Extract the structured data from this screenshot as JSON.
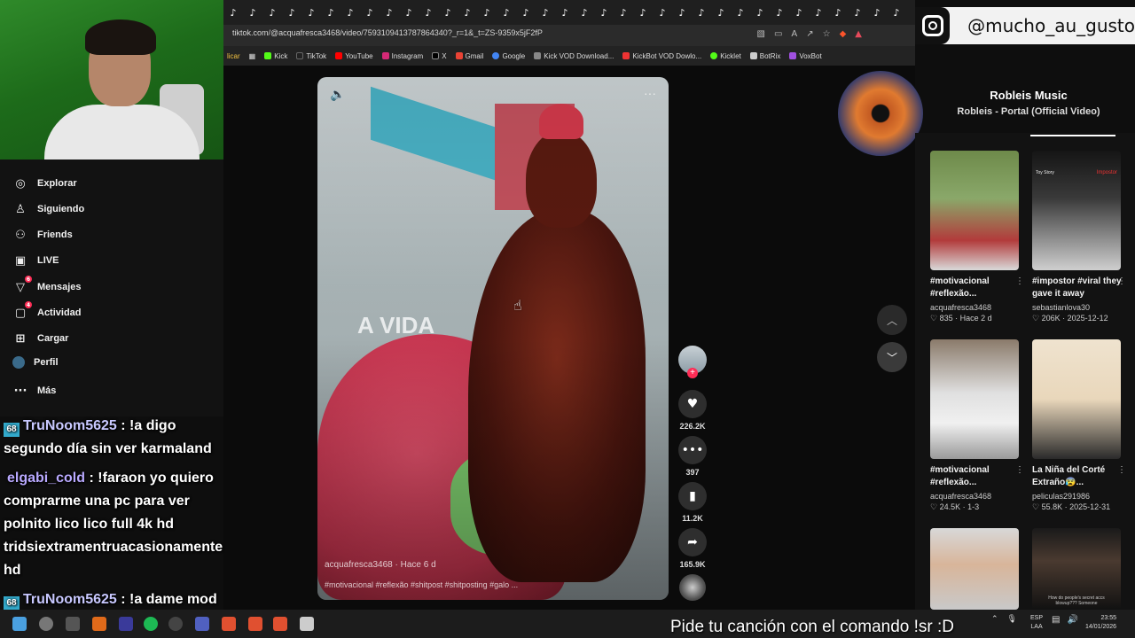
{
  "browser": {
    "url": "tiktok.com/@acquafresca3468/video/7593109413787864340?_r=1&_t=ZS-9359x5jF2fP",
    "bookmarks": [
      "Kick",
      "TikTok",
      "YouTube",
      "Instagram",
      "X",
      "Gmail",
      "Google",
      "Kick VOD Download...",
      "KickBot VOD Dowlo...",
      "Kicklet",
      "BotRix",
      "VoxBot"
    ],
    "bookmark_partial": "licar"
  },
  "instagram_overlay": {
    "handle": "@mucho_au_gusto"
  },
  "sidebar": {
    "items": [
      {
        "label": "Explorar",
        "icon": "compass-icon"
      },
      {
        "label": "Siguiendo",
        "icon": "following-icon"
      },
      {
        "label": "Friends",
        "icon": "friends-icon"
      },
      {
        "label": "LIVE",
        "icon": "live-icon"
      },
      {
        "label": "Mensajes",
        "icon": "messages-icon",
        "badge": "6"
      },
      {
        "label": "Actividad",
        "icon": "activity-icon",
        "badge": "4"
      },
      {
        "label": "Cargar",
        "icon": "upload-icon"
      },
      {
        "label": "Perfil",
        "icon": "profile-icon"
      },
      {
        "label": "Más",
        "icon": "more-icon"
      }
    ]
  },
  "chat": [
    {
      "user": "TruNoom5625",
      "text": " : !a digo segundo día sin ver karmaland"
    },
    {
      "user": "elgabi_cold",
      "text": " : !faraon yo quiero comprarme una pc para ver polnito lico lico full 4k hd tridsiextramentruacasionamente hd"
    },
    {
      "user": "TruNoom5625",
      "text": " : !a dame mod para banearlos"
    }
  ],
  "video": {
    "caption": "A VIDA",
    "author": "acquafresca3468 · Hace 6 d",
    "tags": "#motivacional #reflexão #shitpost #shitposting #galo ..."
  },
  "actions": {
    "likes": "226.2K",
    "comments": "397",
    "saves": "11.2K",
    "shares": "165.9K"
  },
  "music": {
    "title": "Robleis Music",
    "artist": "Robleis - Portal (Official Video)"
  },
  "recommendations": [
    {
      "desc": "#motivacional #reflexão...",
      "author": "acquafresca3468",
      "meta": "♡ 835 · Hace 2 d"
    },
    {
      "desc": "#impostor #viral they gave it away",
      "author": "sebastianlova30",
      "meta": "♡ 206K · 2025-12-12"
    },
    {
      "desc": "#motivacional #reflexão...",
      "author": "acquafresca3468",
      "meta": "♡ 24.5K · 1-3"
    },
    {
      "desc": "La Niña del Corté Extraño😰...",
      "author": "peliculas291986",
      "meta": "♡ 55.8K · 2025-12-31"
    },
    {
      "desc": "",
      "author": "",
      "meta": ""
    },
    {
      "desc": "",
      "author": "",
      "meta": ""
    }
  ],
  "thumb_text": {
    "toy_story": "Toy Story",
    "impostor": "Impostor",
    "meme": "How do people's secret accs blowup??? Someone"
  },
  "ticker": "Pide tu canción con el comando !sr :D",
  "tray": {
    "lang_top": "ESP",
    "lang_bottom": "LAA",
    "time": "23:55",
    "date": "14/01/2026"
  },
  "colors": {
    "accent": "#fe2c55",
    "background": "#0e0e0e",
    "webcam_green": "#1d6b1a"
  }
}
